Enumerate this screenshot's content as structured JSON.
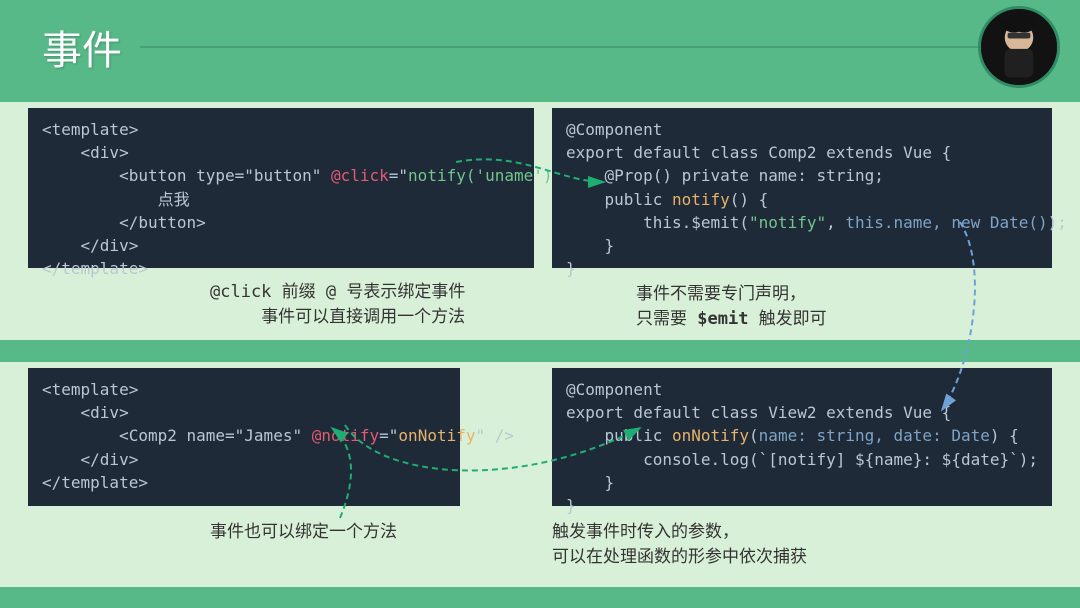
{
  "title": "事件",
  "code": {
    "tl": {
      "l1": "<template>",
      "l2": "    <div>",
      "l3a": "        <button type=\"button\" ",
      "l3b": "@click",
      "l3c": "=\"",
      "l3d": "notify('uname')",
      "l3e": "\">",
      "l4": "            点我",
      "l5": "        </button>",
      "l6": "    </div>",
      "l7": "</template>"
    },
    "tr": {
      "l1": "@Component",
      "l2": "export default class Comp2 extends Vue {",
      "l3": "    @Prop() private name: string;",
      "l4a": "    public ",
      "l4b": "notify",
      "l4c": "() {",
      "l5a": "        this.$emit(",
      "l5b": "\"notify\"",
      "l5c": ", ",
      "l5d": "this.name, new Date()",
      "l5e": ");",
      "l6": "    }",
      "l7": "}"
    },
    "bl": {
      "l1": "<template>",
      "l2": "    <div>",
      "l3a": "        <Comp2 name=\"James\" ",
      "l3b": "@notify",
      "l3c": "=\"",
      "l3d": "onNotify",
      "l3e": "\" />",
      "l4": "    </div>",
      "l5": "</template>"
    },
    "br": {
      "l1": "@Component",
      "l2": "export default class View2 extends Vue {",
      "l3a": "    public ",
      "l3b": "onNotify",
      "l3c": "(",
      "l3d": "name: string, date: Date",
      "l3e": ") {",
      "l4": "        console.log(`[notify] ${name}: ${date}`);",
      "l5": "    }",
      "l6": "}"
    }
  },
  "comments": {
    "tl_line1_pre": "@click",
    "tl_line1_post": "  前缀 @ 号表示绑定事件",
    "tl_line2": "事件可以直接调用一个方法",
    "tr_line1": "事件不需要专门声明，",
    "tr_line2_pre": "只需要 ",
    "tr_line2_em": "$emit",
    "tr_line2_post": " 触发即可",
    "bl": "事件也可以绑定一个方法",
    "br_line1": "触发事件时传入的参数，",
    "br_line2": "可以在处理函数的形参中依次捕获"
  }
}
